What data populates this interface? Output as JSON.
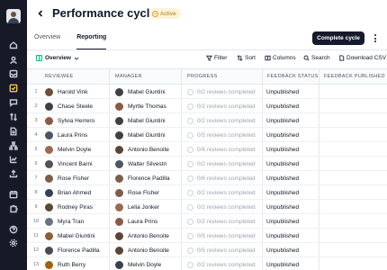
{
  "header": {
    "title": "Performance cycle",
    "status": "Active",
    "primary_action": "Complete cycle"
  },
  "tabs": [
    {
      "label": "Overview",
      "active": false
    },
    {
      "label": "Reporting",
      "active": true
    }
  ],
  "toolbar": {
    "view_label": "Overview",
    "filter": "Filter",
    "sort": "Sort",
    "columns": "Columns",
    "search": "Search",
    "download": "Download CSV"
  },
  "table": {
    "columns": [
      "REVIEWEE",
      "MANAGER",
      "PROGRESS",
      "FEEDBACK STATUS",
      "FEEDBACK PUBLISHED"
    ],
    "rows": [
      {
        "num": "1",
        "reviewee": "Harold Vink",
        "manager": "Mabel Giuntini",
        "progress": "0/2 reviews completed",
        "status": "Unpublished"
      },
      {
        "num": "2",
        "reviewee": "Chase Steele",
        "manager": "Myrtle Thomas",
        "progress": "0/2 reviews completed",
        "status": "Unpublished"
      },
      {
        "num": "3",
        "reviewee": "Sylvia Herrero",
        "manager": "Mabel Giuntini",
        "progress": "0/2 reviews completed",
        "status": "Unpublished"
      },
      {
        "num": "4",
        "reviewee": "Laura Prins",
        "manager": "Mabel Giuntini",
        "progress": "0/5 reviews completed",
        "status": "Unpublished"
      },
      {
        "num": "5",
        "reviewee": "Melvin Doyle",
        "manager": "Antonio Benoite",
        "progress": "0/6 reviews completed",
        "status": "Unpublished"
      },
      {
        "num": "6",
        "reviewee": "Vincent Barni",
        "manager": "Walter Silvestri",
        "progress": "0/2 reviews completed",
        "status": "Unpublished"
      },
      {
        "num": "7",
        "reviewee": "Rose Fisher",
        "manager": "Florence Padilla",
        "progress": "0/6 reviews completed",
        "status": "Unpublished"
      },
      {
        "num": "8",
        "reviewee": "Brian Ahmed",
        "manager": "Rose Fisher",
        "progress": "0/2 reviews completed",
        "status": "Unpublished"
      },
      {
        "num": "9",
        "reviewee": "Rodney Piras",
        "manager": "Lelia Jonker",
        "progress": "0/2 reviews completed",
        "status": "Unpublished"
      },
      {
        "num": "10",
        "reviewee": "Myra Tran",
        "manager": "Laura Prins",
        "progress": "0/2 reviews completed",
        "status": "Unpublished"
      },
      {
        "num": "11",
        "reviewee": "Mabel Giuntini",
        "manager": "Antonio Benoite",
        "progress": "0/5 reviews completed",
        "status": "Unpublished"
      },
      {
        "num": "12",
        "reviewee": "Florence Padilla",
        "manager": "Antonio Benoite",
        "progress": "0/5 reviews completed",
        "status": "Unpublished"
      },
      {
        "num": "13",
        "reviewee": "Ruth Berry",
        "manager": "Melvin Doyle",
        "progress": "0/2 reviews completed",
        "status": "Unpublished"
      }
    ]
  },
  "sidebar": {
    "icons": [
      "home-icon",
      "user-icon",
      "inbox-icon",
      "check-square-icon",
      "message-icon",
      "transfer-icon",
      "document-icon",
      "hierarchy-icon",
      "chart-icon",
      "upload-icon",
      "calendar-icon",
      "puzzle-icon",
      "help-icon",
      "settings-icon"
    ],
    "active_index": 3
  },
  "colors": {
    "sidebar_bg": "#171a26",
    "active_icon": "#f5c54a",
    "badge_bg": "#fdf3d8",
    "badge_text": "#b7791f",
    "primary_button": "#151a2d"
  }
}
